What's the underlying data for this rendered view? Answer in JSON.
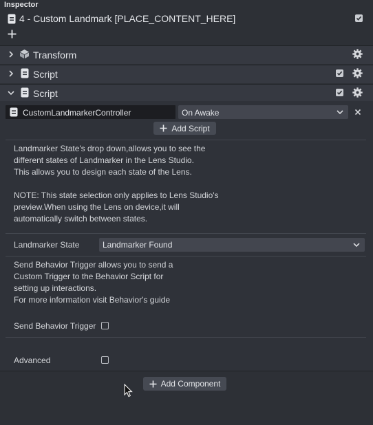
{
  "inspector": {
    "title": "Inspector",
    "object_name": "4 - Custom Landmark [PLACE_CONTENT_HERE]"
  },
  "components": {
    "transform_label": "Transform",
    "script1_label": "Script",
    "script2_label": "Script"
  },
  "script": {
    "script_asset": "CustomLandmarkerController",
    "event_value": "On Awake",
    "add_script_label": "Add Script",
    "description_1": [
      "Landmarker State's drop down,allows you to see the",
      "different states of Landmarker in the Lens Studio.",
      "This allows you to design each state of the Lens."
    ],
    "description_2": [
      "NOTE: This state selection only applies to Lens Studio's",
      "preview.When using the Lens on device,it will",
      "automatically switch between states."
    ],
    "state_label": "Landmarker State",
    "state_value": "Landmarker Found",
    "description_3": [
      "Send Behavior Trigger allows you to send a",
      "Custom Trigger to the Behavior Script for",
      "setting up interactions.",
      "For more information visit Behavior's guide"
    ],
    "trigger_label": "Send Behavior Trigger",
    "advanced_label": "Advanced"
  },
  "add_component_label": "Add Component",
  "colors": {
    "background": "#2d3036",
    "bar": "#363941",
    "dropdown": "#43464f",
    "field_dark": "#1c1d21"
  }
}
